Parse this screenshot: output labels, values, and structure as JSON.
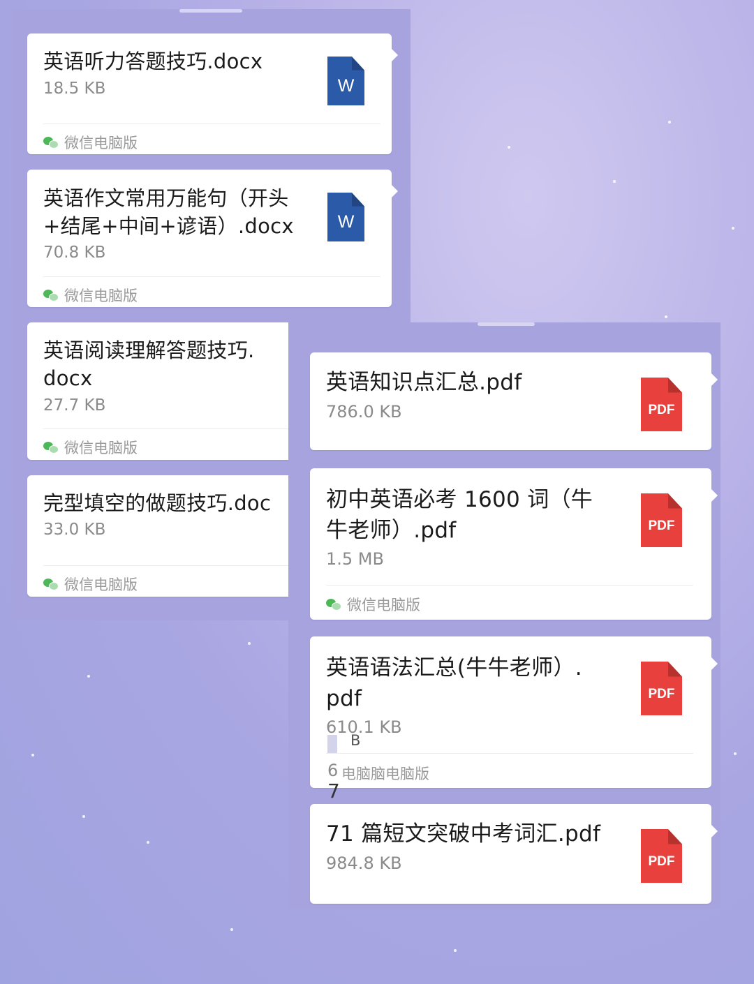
{
  "source_label": "微信电脑版",
  "left_panel": {
    "files": [
      {
        "name": "英语听力答题技巧.docx",
        "size": "18.5 KB",
        "icon": "W",
        "type": "word-icon"
      },
      {
        "name": "英语作文常用万能句（开头\n+结尾+中间+谚语）.docx",
        "size": "70.8 KB",
        "icon": "W",
        "type": "word-icon"
      },
      {
        "name": "英语阅读理解答题技巧.\ndocx",
        "size": "27.7 KB"
      },
      {
        "name": "完型填空的做题技巧.doc",
        "size": "33.0 KB"
      }
    ]
  },
  "right_panel": {
    "files": [
      {
        "name": "英语知识点汇总.pdf",
        "size": "786.0 KB",
        "icon": "PDF",
        "type": "pdf-icon"
      },
      {
        "name": "初中英语必考 1600 词（牛\n牛老师）.pdf",
        "size": "1.5 MB",
        "icon": "PDF",
        "type": "pdf-icon"
      },
      {
        "name": "英语语法汇总(牛牛老师）.\npdf",
        "size": "610.1 KB",
        "icon": "PDF",
        "type": "pdf-icon"
      },
      {
        "name": "71 篇短文突破中考词汇.pdf",
        "size": "984.8 KB",
        "icon": "PDF",
        "type": "pdf-icon"
      }
    ],
    "glitch": {
      "fragment_b": "B",
      "fragment_6": "6",
      "source_corrupted": "电脑脑电脑版",
      "fragment_7": "7"
    }
  },
  "colors": {
    "word": "#2b5aa8",
    "pdf": "#e8403c",
    "wechat_green": "#4cb857",
    "panel": "#a7a3de",
    "background": "#b9b3e8"
  }
}
